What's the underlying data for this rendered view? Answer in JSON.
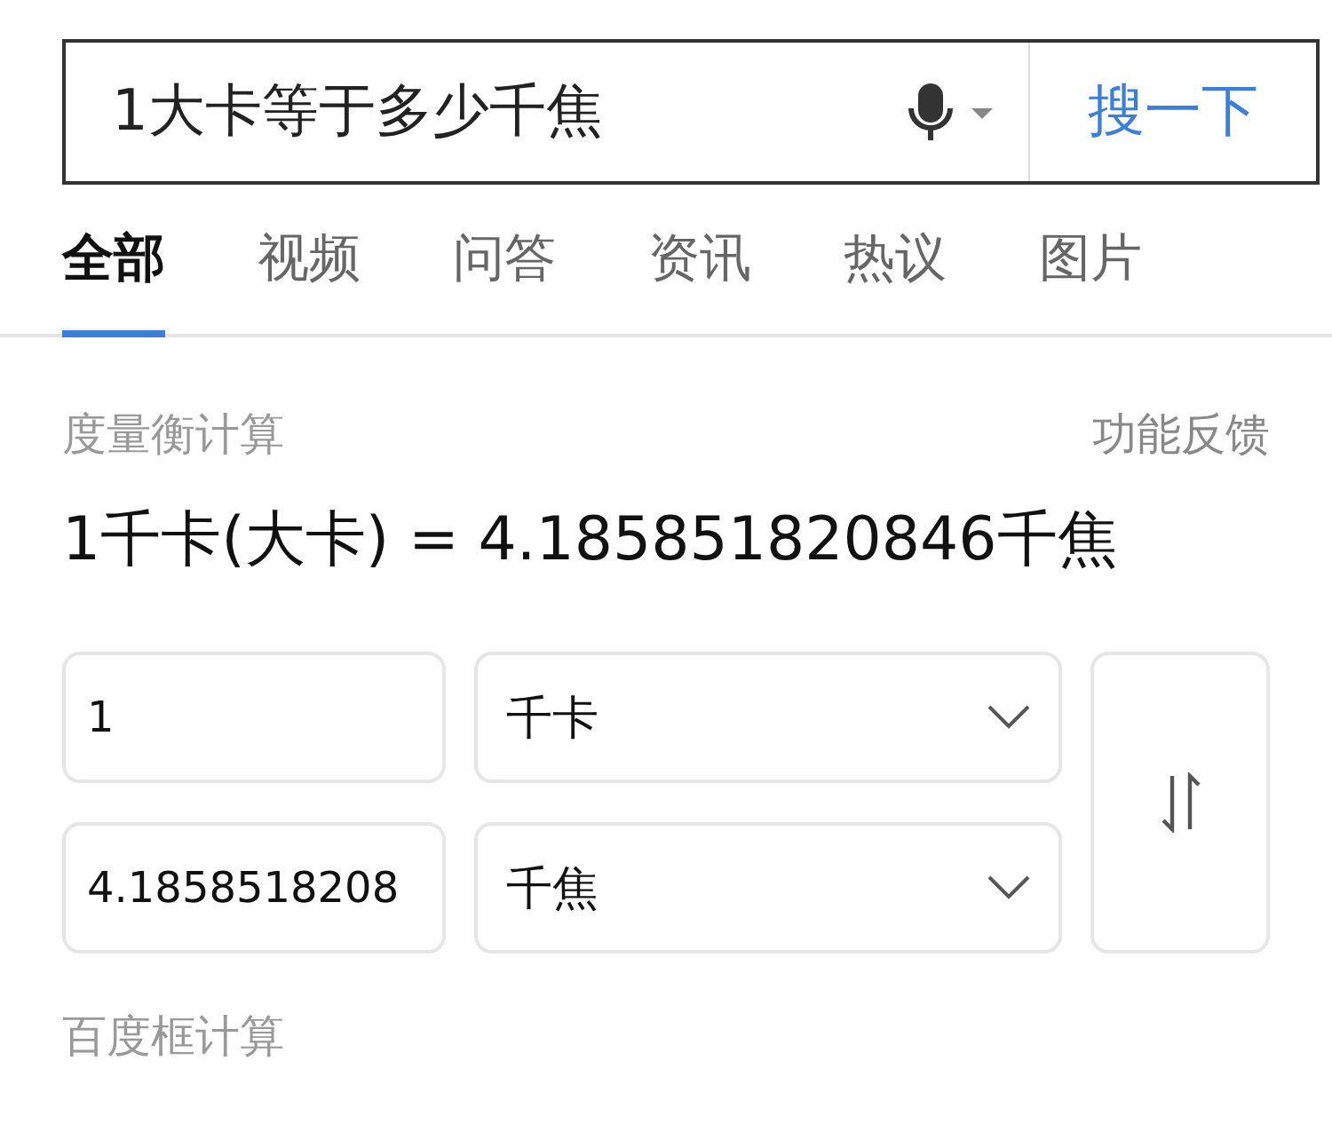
{
  "search": {
    "query": "1大卡等于多少千焦",
    "button": "搜一下"
  },
  "tabs": [
    {
      "label": "全部",
      "selected": true
    },
    {
      "label": "视频",
      "selected": false
    },
    {
      "label": "问答",
      "selected": false
    },
    {
      "label": "资讯",
      "selected": false
    },
    {
      "label": "热议",
      "selected": false
    },
    {
      "label": "图片",
      "selected": false
    }
  ],
  "card": {
    "title": "度量衡计算",
    "feedback": "功能反馈",
    "result": "1千卡(大卡) = 4.185851820846千焦",
    "rows": [
      {
        "value": "1",
        "unit": "千卡"
      },
      {
        "value": "4.1858518208",
        "unit": "千焦"
      }
    ],
    "source": "百度框计算"
  }
}
